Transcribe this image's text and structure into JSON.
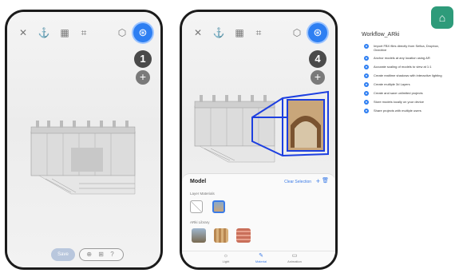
{
  "phone_left": {
    "step_number": "1",
    "plus_label": "+",
    "save_label": "Save",
    "tools_label": "⊕ ⊞ ?"
  },
  "phone_right": {
    "step_number": "4",
    "plus_label": "+",
    "panel": {
      "title": "Model",
      "clear_selection": "Clear Selection",
      "add": "+",
      "delete": "🗑",
      "layer_materials_label": "Layer Materials",
      "library_label": "ARki Library"
    },
    "tabs": [
      {
        "label": "Light",
        "icon": "☼"
      },
      {
        "label": "Material",
        "icon": "✎"
      },
      {
        "label": "Animation",
        "icon": "▭"
      }
    ]
  },
  "workflow": {
    "title": "Workflow_ARki",
    "features": [
      "Import FBX files directly from Sefica, Dropbox, Onedrive",
      "Anchor models at any location using AR",
      "Accurate scaling of models to view at 1:1",
      "Create realtime shadows with interactive lighting",
      "Create multiple 3d Layers",
      "Create and save unlimited projects",
      "Store models locally on your device",
      "Share projects with multiple users"
    ]
  },
  "colors": {
    "accent": "#2e7ff2",
    "logo": "#2e9b7a",
    "selection": "#1d3fe0"
  }
}
